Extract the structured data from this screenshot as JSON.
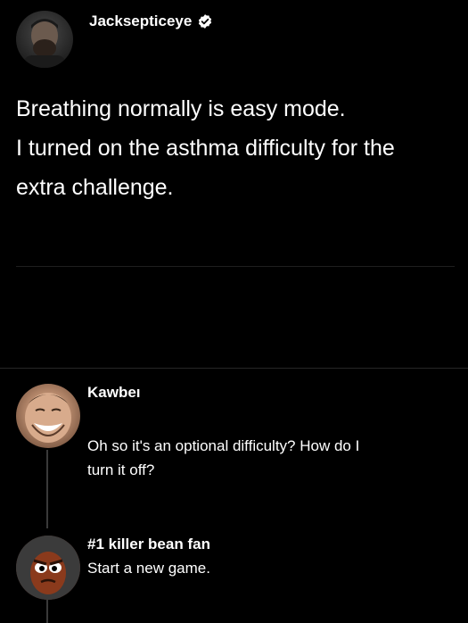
{
  "tweet": {
    "author": "Jacksepticeye",
    "verified_icon": "verified-badge-icon",
    "text_lines": [
      "Breathing normally is easy mode.",
      "I turned on the asthma difficulty for the",
      "extra challenge."
    ]
  },
  "replies": [
    {
      "author": "Kawbeı",
      "text_lines": [
        "Oh so it's an optional difficulty? How do I",
        "turn it off?"
      ]
    },
    {
      "author": "#1 killer bean fan",
      "text_lines": [
        "Start a new game."
      ]
    }
  ],
  "colors": {
    "background": "#000000",
    "text": "#ffffff",
    "divider": "#1f1f1f",
    "thread_line": "#3a3a3a",
    "verified_badge": "#ffffff"
  }
}
